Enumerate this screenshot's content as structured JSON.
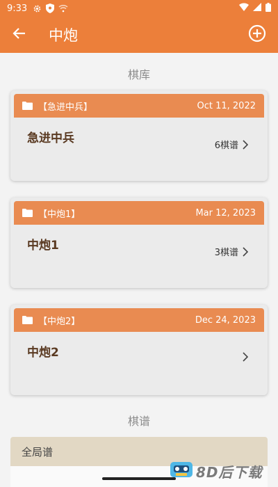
{
  "status_bar": {
    "time": "9:33"
  },
  "app_bar": {
    "title": "中炮"
  },
  "sections": {
    "library_title": "棋库",
    "records_title": "棋谱"
  },
  "cards": [
    {
      "header": "【急进中兵】",
      "date": "Oct 11, 2022",
      "name": "急进中兵",
      "count": "6棋谱"
    },
    {
      "header": "【中炮1】",
      "date": "Mar 12, 2023",
      "name": "中炮1",
      "count": "3棋谱"
    },
    {
      "header": "【中炮2】",
      "date": "Dec 24, 2023",
      "name": "中炮2",
      "count": ""
    }
  ],
  "global_record": {
    "label": "全局谱"
  },
  "watermark": {
    "text": "8D后下载"
  },
  "colors": {
    "accent": "#ec7f3a",
    "card_header": "#e98b51",
    "card_bg": "#ebebeb",
    "global_bg": "#e2d8c4"
  },
  "icons": {
    "back": "arrow-left-icon",
    "add": "plus-circle-icon",
    "folder": "folder-icon",
    "chevron": "chevron-right-icon"
  }
}
